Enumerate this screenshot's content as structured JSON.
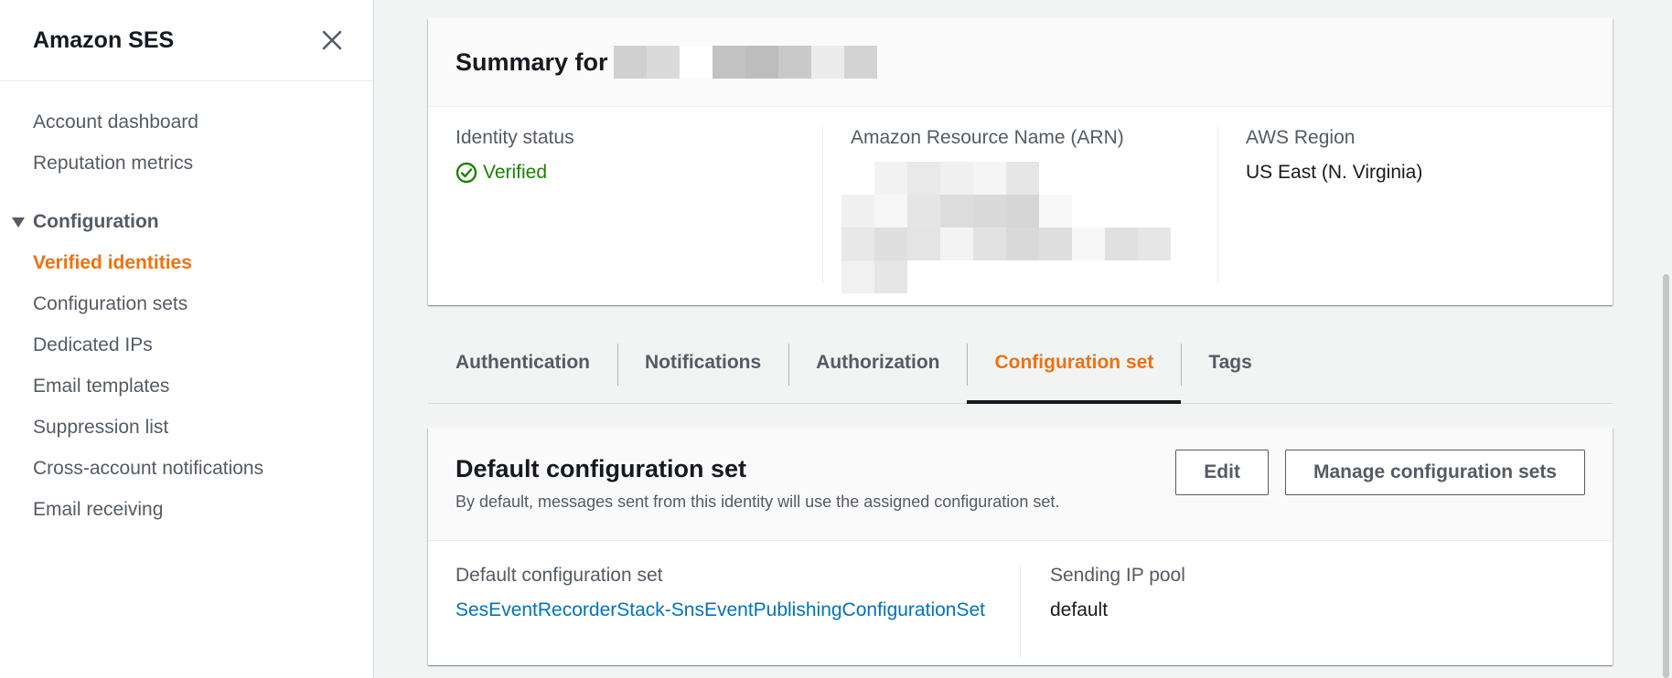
{
  "sidebar": {
    "title": "Amazon SES",
    "items_top": [
      {
        "label": "Account dashboard"
      },
      {
        "label": "Reputation metrics"
      }
    ],
    "section": {
      "label": "Configuration"
    },
    "items": [
      {
        "label": "Verified identities",
        "active": true
      },
      {
        "label": "Configuration sets"
      },
      {
        "label": "Dedicated IPs"
      },
      {
        "label": "Email templates"
      },
      {
        "label": "Suppression list"
      },
      {
        "label": "Cross-account notifications"
      },
      {
        "label": "Email receiving"
      }
    ]
  },
  "summary": {
    "title": "Summary for",
    "identity_status_label": "Identity status",
    "identity_status_value": "Verified",
    "arn_label": "Amazon Resource Name (ARN)",
    "region_label": "AWS Region",
    "region_value": "US East (N. Virginia)"
  },
  "tabs": [
    {
      "label": "Authentication"
    },
    {
      "label": "Notifications"
    },
    {
      "label": "Authorization"
    },
    {
      "label": "Configuration set",
      "active": true
    },
    {
      "label": "Tags"
    }
  ],
  "config_panel": {
    "title": "Default configuration set",
    "description": "By default, messages sent from this identity will use the assigned configuration set.",
    "edit_label": "Edit",
    "manage_label": "Manage configuration sets",
    "default_set_label": "Default configuration set",
    "default_set_value": "SesEventRecorderStack-SnsEventPublishingConfigurationSet",
    "ip_pool_label": "Sending IP pool",
    "ip_pool_value": "default"
  },
  "colors": {
    "accent": "#ec7211",
    "link": "#0073bb",
    "success": "#1d8102",
    "text": "#16191f",
    "muted": "#545b64"
  }
}
